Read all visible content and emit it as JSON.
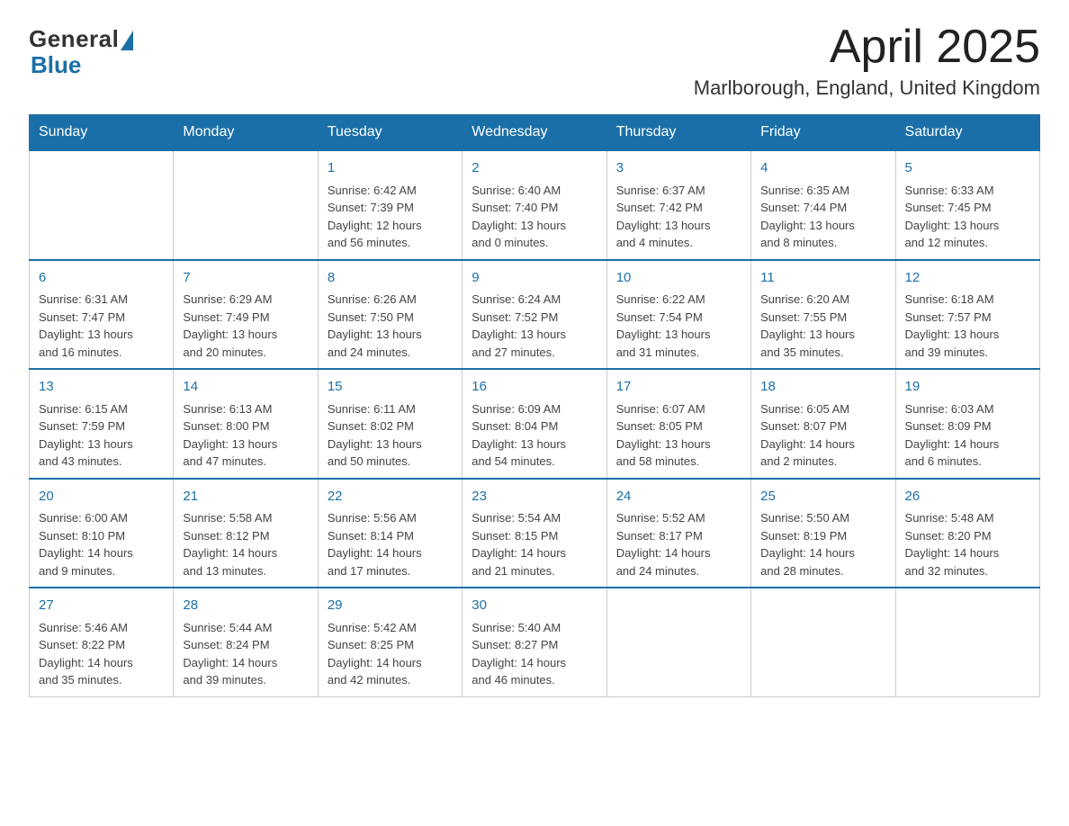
{
  "logo": {
    "general": "General",
    "blue": "Blue"
  },
  "title": "April 2025",
  "location": "Marlborough, England, United Kingdom",
  "weekdays": [
    "Sunday",
    "Monday",
    "Tuesday",
    "Wednesday",
    "Thursday",
    "Friday",
    "Saturday"
  ],
  "weeks": [
    [
      {
        "day": "",
        "info": ""
      },
      {
        "day": "",
        "info": ""
      },
      {
        "day": "1",
        "info": "Sunrise: 6:42 AM\nSunset: 7:39 PM\nDaylight: 12 hours\nand 56 minutes."
      },
      {
        "day": "2",
        "info": "Sunrise: 6:40 AM\nSunset: 7:40 PM\nDaylight: 13 hours\nand 0 minutes."
      },
      {
        "day": "3",
        "info": "Sunrise: 6:37 AM\nSunset: 7:42 PM\nDaylight: 13 hours\nand 4 minutes."
      },
      {
        "day": "4",
        "info": "Sunrise: 6:35 AM\nSunset: 7:44 PM\nDaylight: 13 hours\nand 8 minutes."
      },
      {
        "day": "5",
        "info": "Sunrise: 6:33 AM\nSunset: 7:45 PM\nDaylight: 13 hours\nand 12 minutes."
      }
    ],
    [
      {
        "day": "6",
        "info": "Sunrise: 6:31 AM\nSunset: 7:47 PM\nDaylight: 13 hours\nand 16 minutes."
      },
      {
        "day": "7",
        "info": "Sunrise: 6:29 AM\nSunset: 7:49 PM\nDaylight: 13 hours\nand 20 minutes."
      },
      {
        "day": "8",
        "info": "Sunrise: 6:26 AM\nSunset: 7:50 PM\nDaylight: 13 hours\nand 24 minutes."
      },
      {
        "day": "9",
        "info": "Sunrise: 6:24 AM\nSunset: 7:52 PM\nDaylight: 13 hours\nand 27 minutes."
      },
      {
        "day": "10",
        "info": "Sunrise: 6:22 AM\nSunset: 7:54 PM\nDaylight: 13 hours\nand 31 minutes."
      },
      {
        "day": "11",
        "info": "Sunrise: 6:20 AM\nSunset: 7:55 PM\nDaylight: 13 hours\nand 35 minutes."
      },
      {
        "day": "12",
        "info": "Sunrise: 6:18 AM\nSunset: 7:57 PM\nDaylight: 13 hours\nand 39 minutes."
      }
    ],
    [
      {
        "day": "13",
        "info": "Sunrise: 6:15 AM\nSunset: 7:59 PM\nDaylight: 13 hours\nand 43 minutes."
      },
      {
        "day": "14",
        "info": "Sunrise: 6:13 AM\nSunset: 8:00 PM\nDaylight: 13 hours\nand 47 minutes."
      },
      {
        "day": "15",
        "info": "Sunrise: 6:11 AM\nSunset: 8:02 PM\nDaylight: 13 hours\nand 50 minutes."
      },
      {
        "day": "16",
        "info": "Sunrise: 6:09 AM\nSunset: 8:04 PM\nDaylight: 13 hours\nand 54 minutes."
      },
      {
        "day": "17",
        "info": "Sunrise: 6:07 AM\nSunset: 8:05 PM\nDaylight: 13 hours\nand 58 minutes."
      },
      {
        "day": "18",
        "info": "Sunrise: 6:05 AM\nSunset: 8:07 PM\nDaylight: 14 hours\nand 2 minutes."
      },
      {
        "day": "19",
        "info": "Sunrise: 6:03 AM\nSunset: 8:09 PM\nDaylight: 14 hours\nand 6 minutes."
      }
    ],
    [
      {
        "day": "20",
        "info": "Sunrise: 6:00 AM\nSunset: 8:10 PM\nDaylight: 14 hours\nand 9 minutes."
      },
      {
        "day": "21",
        "info": "Sunrise: 5:58 AM\nSunset: 8:12 PM\nDaylight: 14 hours\nand 13 minutes."
      },
      {
        "day": "22",
        "info": "Sunrise: 5:56 AM\nSunset: 8:14 PM\nDaylight: 14 hours\nand 17 minutes."
      },
      {
        "day": "23",
        "info": "Sunrise: 5:54 AM\nSunset: 8:15 PM\nDaylight: 14 hours\nand 21 minutes."
      },
      {
        "day": "24",
        "info": "Sunrise: 5:52 AM\nSunset: 8:17 PM\nDaylight: 14 hours\nand 24 minutes."
      },
      {
        "day": "25",
        "info": "Sunrise: 5:50 AM\nSunset: 8:19 PM\nDaylight: 14 hours\nand 28 minutes."
      },
      {
        "day": "26",
        "info": "Sunrise: 5:48 AM\nSunset: 8:20 PM\nDaylight: 14 hours\nand 32 minutes."
      }
    ],
    [
      {
        "day": "27",
        "info": "Sunrise: 5:46 AM\nSunset: 8:22 PM\nDaylight: 14 hours\nand 35 minutes."
      },
      {
        "day": "28",
        "info": "Sunrise: 5:44 AM\nSunset: 8:24 PM\nDaylight: 14 hours\nand 39 minutes."
      },
      {
        "day": "29",
        "info": "Sunrise: 5:42 AM\nSunset: 8:25 PM\nDaylight: 14 hours\nand 42 minutes."
      },
      {
        "day": "30",
        "info": "Sunrise: 5:40 AM\nSunset: 8:27 PM\nDaylight: 14 hours\nand 46 minutes."
      },
      {
        "day": "",
        "info": ""
      },
      {
        "day": "",
        "info": ""
      },
      {
        "day": "",
        "info": ""
      }
    ]
  ]
}
